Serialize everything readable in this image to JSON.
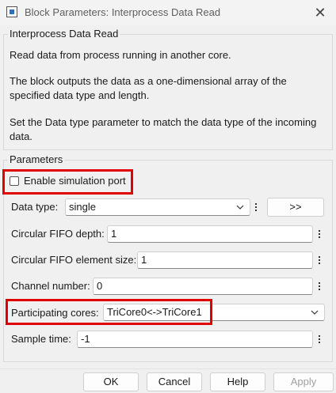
{
  "window": {
    "title": "Block Parameters: Interprocess Data Read",
    "close_glyph": "✕"
  },
  "block": {
    "group_title": "Interprocess Data Read",
    "description": [
      "Read data from process running in another core.",
      "The block outputs the data as a one-dimensional array of the",
      "specified data type and length.",
      "Set the Data type parameter to match the data type of the incoming",
      "data."
    ]
  },
  "parameters": {
    "group_title": "Parameters",
    "enable_sim_port": {
      "label": "Enable simulation port",
      "checked": false
    },
    "data_type": {
      "label": "Data type:",
      "value": "single",
      "button_label": ">>"
    },
    "fifo_depth": {
      "label": "Circular FIFO depth:",
      "value": "1"
    },
    "fifo_element_size": {
      "label": "Circular FIFO element size:",
      "value": "1"
    },
    "channel_number": {
      "label": "Channel number:",
      "value": "0"
    },
    "participating_cores": {
      "label": "Participating cores:",
      "value": "TriCore0<->TriCore1"
    },
    "sample_time": {
      "label": "Sample time:",
      "value": "-1"
    }
  },
  "footer": {
    "ok_label": "OK",
    "cancel_label": "Cancel",
    "help_label": "Help",
    "apply_label": "Apply"
  },
  "colors": {
    "highlight": "#e00000",
    "background": "#f0f0f0"
  },
  "icons": {
    "app": "simulink-block-icon",
    "close": "close-icon",
    "dropdown": "chevron-down-icon",
    "more": "kebab-menu-icon"
  }
}
